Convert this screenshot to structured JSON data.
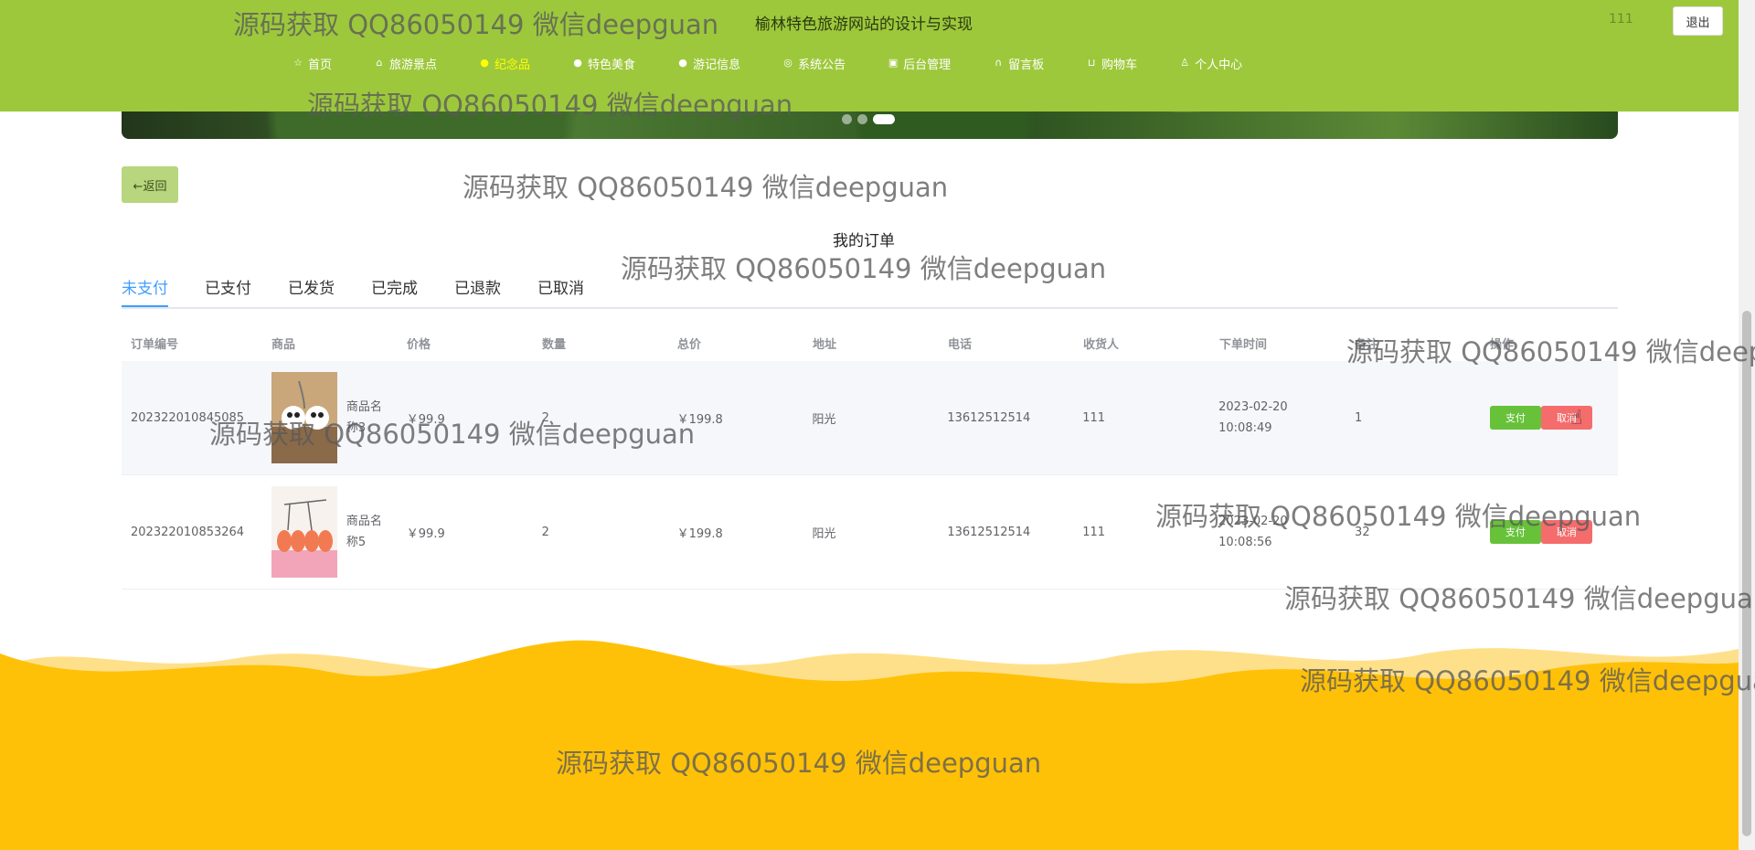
{
  "header": {
    "site_title": "榆林特色旅游网站的设计与实现",
    "user_name": "111",
    "logout_label": "退出",
    "bg_color": "#9dc83c",
    "nav": [
      {
        "label": "首页",
        "icon": "star-icon"
      },
      {
        "label": "旅游景点",
        "icon": "house-icon"
      },
      {
        "label": "纪念品",
        "icon": "dot-icon",
        "active": true
      },
      {
        "label": "特色美食",
        "icon": "info-icon"
      },
      {
        "label": "游记信息",
        "icon": "info-icon"
      },
      {
        "label": "系统公告",
        "icon": "globe-icon"
      },
      {
        "label": "后台管理",
        "icon": "admin-icon"
      },
      {
        "label": "留言板",
        "icon": "headset-icon"
      },
      {
        "label": "购物车",
        "icon": "cart-icon"
      },
      {
        "label": "个人中心",
        "icon": "user-icon"
      }
    ]
  },
  "back_label": "←返回",
  "page_title": "我的订单",
  "tabs": [
    "未支付",
    "已支付",
    "已发货",
    "已完成",
    "已退款",
    "已取消"
  ],
  "table": {
    "headers": [
      "订单编号",
      "商品",
      "价格",
      "数量",
      "总价",
      "地址",
      "电话",
      "收货人",
      "下单时间",
      "备注",
      "操作"
    ],
    "rows": [
      {
        "order_no": "202322010845085",
        "goods": "商品名称3",
        "price": "￥99.9",
        "qty": "2",
        "total": "￥199.8",
        "address": "阳光",
        "phone": "13612512514",
        "receiver": "111",
        "time": "2023-02-20 10:08:49",
        "remark": "1"
      },
      {
        "order_no": "202322010853264",
        "goods": "商品名称5",
        "price": "￥99.9",
        "qty": "2",
        "total": "￥199.8",
        "address": "阳光",
        "phone": "13612512514",
        "receiver": "111",
        "time": "2023-02-20 10:08:56",
        "remark": "32"
      }
    ],
    "pay_label": "支付",
    "cancel_label": "取消"
  },
  "watermark": "源码获取 QQ86050149 微信deepguan",
  "colors": {
    "accent": "#409eff",
    "pay": "#67c23a",
    "cancel": "#f56c6c",
    "footer": "#ffc107"
  }
}
